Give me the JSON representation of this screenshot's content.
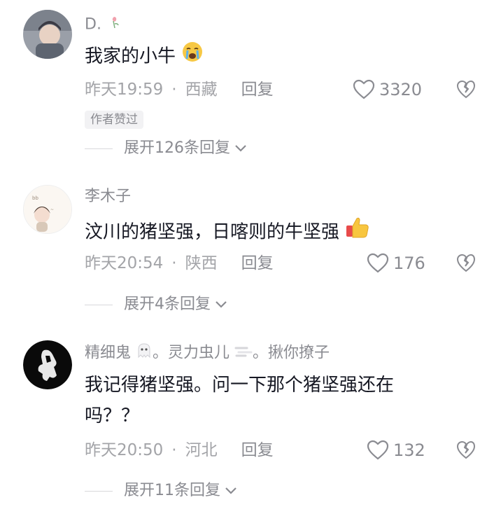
{
  "comments": [
    {
      "username": "D.",
      "text": "我家的小牛",
      "time": "昨天19:59",
      "location": "西藏",
      "reply_label": "回复",
      "likes": "3320",
      "badge": "作者赞过",
      "expand_label": "展开126条回复"
    },
    {
      "username": "李木子",
      "text": "汶川的猪坚强，日喀则的牛坚强",
      "time": "昨天20:54",
      "location": "陕西",
      "reply_label": "回复",
      "likes": "176",
      "expand_label": "展开4条回复"
    },
    {
      "username_part1": "精细鬼",
      "username_part2": "。灵力虫儿",
      "username_part3": "。揪你撩子",
      "text_line1": "我记得猪坚强。问一下那个猪坚强还在",
      "text_line2": "吗？？",
      "time": "昨天20:50",
      "location": "河北",
      "reply_label": "回复",
      "likes": "132",
      "expand_label": "展开11条回复"
    }
  ],
  "icons": {
    "like": "heart-outline-icon",
    "dislike": "broken-heart-icon",
    "expand": "chevron-down-icon"
  }
}
